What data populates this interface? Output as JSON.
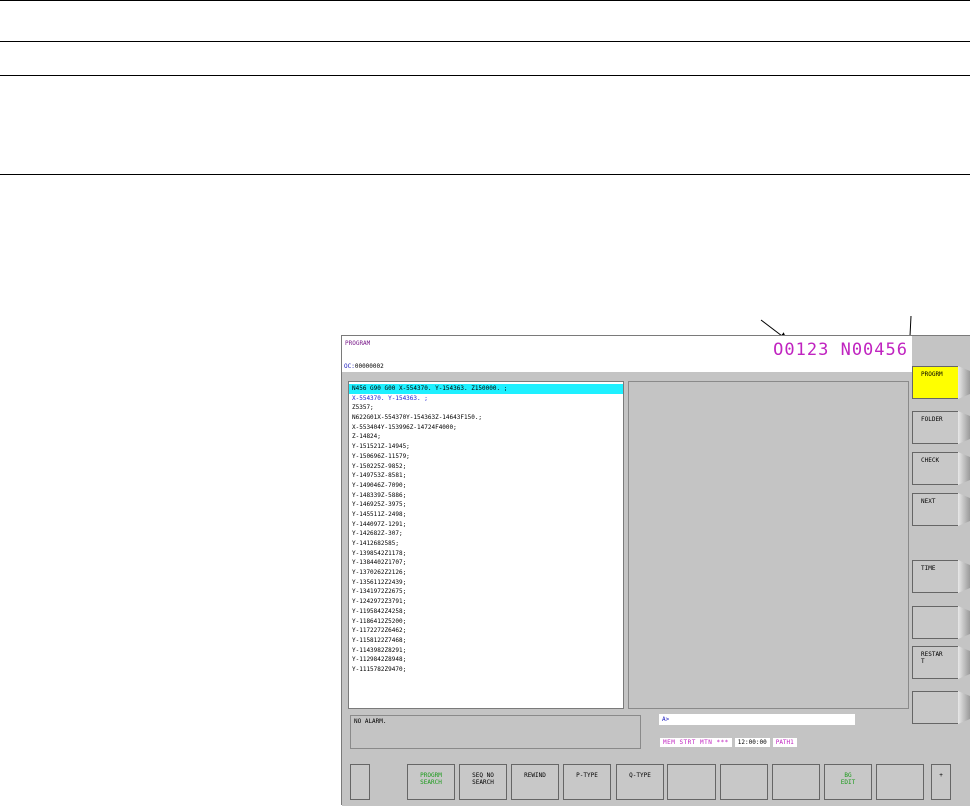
{
  "screen": {
    "title": "PROGRAM",
    "program_number": "O0123 N00456",
    "oc_label": "OC:",
    "oc_value": "00000002",
    "program_lines": [
      {
        "text": "N456 G90 G00 X-554370. Y-154363. Z150000. ;",
        "style": "cursor"
      },
      {
        "text": "X-554370. Y-154363. ;",
        "style": "blue"
      },
      {
        "text": "Z5357;",
        "style": ""
      },
      {
        "text": "N622G01X-554370Y-154363Z-14643F150.;",
        "style": ""
      },
      {
        "text": "X-553404Y-153996Z-14724F4000;",
        "style": ""
      },
      {
        "text": "Z-14824;",
        "style": ""
      },
      {
        "text": "Y-151521Z-14945;",
        "style": ""
      },
      {
        "text": "Y-150696Z-11579;",
        "style": ""
      },
      {
        "text": "Y-150225Z-9852;",
        "style": ""
      },
      {
        "text": "Y-149753Z-8581;",
        "style": ""
      },
      {
        "text": "Y-149046Z-7090;",
        "style": ""
      },
      {
        "text": "Y-148339Z-5886;",
        "style": ""
      },
      {
        "text": "Y-146925Z-3975;",
        "style": ""
      },
      {
        "text": "Y-145511Z-2498;",
        "style": ""
      },
      {
        "text": "Y-144097Z-1291;",
        "style": ""
      },
      {
        "text": "Y-142682Z-307;",
        "style": ""
      },
      {
        "text": "Y-1412682585;",
        "style": ""
      },
      {
        "text": "Y-1398542Z1178;",
        "style": ""
      },
      {
        "text": "Y-1384402Z1707;",
        "style": ""
      },
      {
        "text": "Y-1370262Z2126;",
        "style": ""
      },
      {
        "text": "Y-1356112Z2439;",
        "style": ""
      },
      {
        "text": "Y-1341972Z2675;",
        "style": ""
      },
      {
        "text": "Y-1242972Z3791;",
        "style": ""
      },
      {
        "text": "Y-1195842Z4258;",
        "style": ""
      },
      {
        "text": "Y-1186412Z5200;",
        "style": ""
      },
      {
        "text": "Y-1172272Z6462;",
        "style": ""
      },
      {
        "text": "Y-1158122Z7468;",
        "style": ""
      },
      {
        "text": "Y-1143982Z8291;",
        "style": ""
      },
      {
        "text": "Y-1129842Z8948;",
        "style": ""
      },
      {
        "text": "Y-1115782Z9470;",
        "style": ""
      }
    ],
    "alarm_text": "NO ALARM.",
    "key_input_prompt": "A>",
    "status_modes": "MEM  STRT MTN  ***",
    "status_time": "12:00:00",
    "status_path": "PATH1",
    "vertical_softkeys": [
      {
        "line1": "PROGRM",
        "line2": "",
        "active": true
      },
      {
        "line1": "FOLDER",
        "line2": "",
        "active": false
      },
      {
        "line1": "CHECK",
        "line2": "",
        "active": false
      },
      {
        "line1": "NEXT",
        "line2": "",
        "active": false
      },
      {
        "line1": "",
        "line2": "",
        "active": false
      },
      {
        "line1": "TIME",
        "line2": "",
        "active": false
      },
      {
        "line1": "",
        "line2": "",
        "active": false
      },
      {
        "line1": "RESTAR",
        "line2": "T",
        "active": false
      },
      {
        "line1": "",
        "line2": "",
        "active": false
      }
    ],
    "horizontal_softkeys": [
      {
        "line1": "",
        "line2": "",
        "green": false
      },
      {
        "line1": "PROGRM",
        "line2": "SEARCH",
        "green": true
      },
      {
        "line1": "SEQ NO",
        "line2": "SEARCH",
        "green": false
      },
      {
        "line1": "REWIND",
        "line2": "",
        "green": false
      },
      {
        "line1": "P-TYPE",
        "line2": "",
        "green": false
      },
      {
        "line1": "Q-TYPE",
        "line2": "",
        "green": false
      },
      {
        "line1": "",
        "line2": "",
        "green": false
      },
      {
        "line1": "",
        "line2": "",
        "green": false
      },
      {
        "line1": "",
        "line2": "",
        "green": false
      },
      {
        "line1": "BG",
        "line2": "EDIT",
        "green": true
      },
      {
        "line1": "",
        "line2": "",
        "green": false
      },
      {
        "line1": "+",
        "line2": "",
        "green": false
      }
    ]
  },
  "colors": {
    "background": "#c4c4c4",
    "cursor_highlight": "#1ef0ff",
    "active_softkey": "#ffff00",
    "program_number": "#c024c0"
  }
}
